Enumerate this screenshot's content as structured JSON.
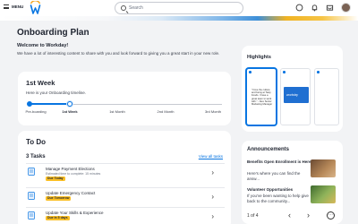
{
  "header": {
    "menu_label": "MENU",
    "search_placeholder": "Search"
  },
  "colors": {
    "accent": "#0875e1",
    "badge": "#fbbf24"
  },
  "page": {
    "title": "Onboarding Plan"
  },
  "welcome": {
    "title": "Welcome to Workday!",
    "body": "We have a lot of interesting content to share with you and look forward to giving you a great start in your new role."
  },
  "week": {
    "title": "1st Week",
    "subtitle": "Here is your Onboarding timeline.",
    "steps": [
      "Pre-boarding",
      "1st Week",
      "1st Month",
      "2nd Month",
      "3rd Month"
    ],
    "current_index": 1
  },
  "todo": {
    "title": "To Do",
    "count": "3 Tasks",
    "view_all": "View all tasks",
    "tasks": [
      {
        "title": "Manage Payment Elections",
        "meta": "Estimated time to complete: 15 minutes",
        "badge": "Due Today"
      },
      {
        "title": "Update Emergency Contact",
        "meta": "",
        "badge": "Due Tomorrow"
      },
      {
        "title": "Update Your Skills & Experience",
        "meta": "",
        "badge": "Due in 5 days"
      }
    ]
  },
  "highlights": {
    "title": "Highlights",
    "quote": "\"I love the culture and being at Tasty Foods. I have a great team to work with.\" - Alex Senior Marketing Manager",
    "image_caption": "workday"
  },
  "announcements": {
    "title": "Announcements",
    "items": [
      {
        "title": "Benefits Open Enrollment is Here",
        "body": "Here's where you can find the answ..."
      },
      {
        "title": "Volunteer Opportunities",
        "body": "If you've been wanting to help give back to the community..."
      }
    ],
    "pager": "1  of  4"
  }
}
